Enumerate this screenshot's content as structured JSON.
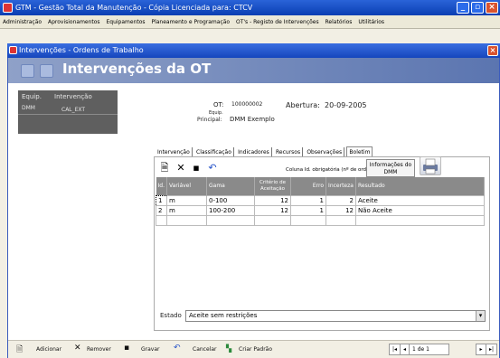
{
  "app": {
    "title": "GTM - Gestão Total da Manutenção  - Cópia Licenciada para: CTCV"
  },
  "menu": [
    "Administração",
    "Aprovisionamentos",
    "Equipamentos",
    "Planeamento e Programação",
    "OT's - Registo de Intervenções",
    "Relatórios",
    "Utilitários"
  ],
  "window": {
    "title": "Intervenções - Ordens de Trabalho",
    "header": "Intervenções da OT"
  },
  "left_list": {
    "headers": [
      "Equip.",
      "Intervenção"
    ],
    "row": [
      "DMM",
      "CAL_EXT"
    ]
  },
  "info": {
    "ot_label": "OT:",
    "ot_value": "100000002",
    "abertura_label": "Abertura:",
    "abertura_value": "20-09-2005",
    "equip_label1": "Equip.",
    "equip_label2": "Principal:",
    "equip_value": "DMM Exemplo"
  },
  "tabs": [
    "Intervenção",
    "Classificação",
    "Indicadores",
    "Recursos",
    "Observações",
    "Boletim"
  ],
  "toolbar": {
    "hint": "Coluna Id. obrigatória (nº de ordem)",
    "info_button_line1": "Informações do",
    "info_button_line2": "DMM"
  },
  "grid": {
    "headers": [
      "Id.",
      "Variável",
      "Gama",
      "Critério de Aceitação",
      "Erro",
      "Incerteza",
      "Resultado"
    ],
    "rows": [
      [
        "1",
        "m",
        "0-100",
        "12",
        "1",
        "2",
        "Aceite"
      ],
      [
        "2",
        "m",
        "100-200",
        "12",
        "1",
        "12",
        "Não Aceite"
      ]
    ]
  },
  "status": {
    "label": "Estado",
    "value": "Aceite sem restrições"
  },
  "bottom": {
    "add": "Adicionar",
    "remove": "Remover",
    "save": "Gravar",
    "cancel": "Cancelar",
    "pattern": "Criar Padrão",
    "record": "1 de 1"
  }
}
